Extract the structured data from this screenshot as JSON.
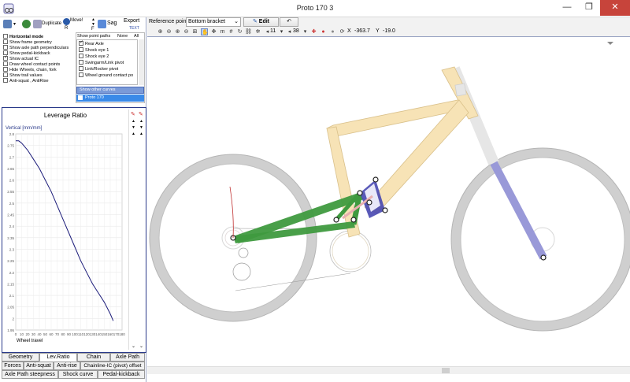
{
  "window": {
    "title": "Proto 170 3",
    "minimize": "—",
    "restore": "❐",
    "close": "✕"
  },
  "left_toolbar": {
    "duplicate_label": "Duplicate",
    "move_label": "Move!",
    "sag_label": "Sag",
    "export_label": "Export",
    "export_sub": "TEXT",
    "r_label": "R",
    "f_label": "F"
  },
  "display_options": [
    {
      "label": "Horizontal mode",
      "checked": false,
      "bold": true
    },
    {
      "label": "Show frame geometry",
      "checked": false,
      "bold": false
    },
    {
      "label": "Show axle path perpendiculars",
      "checked": false,
      "bold": false
    },
    {
      "label": "Show pedal-kickback",
      "checked": false,
      "bold": false
    },
    {
      "label": "Show actual IC",
      "checked": true,
      "bold": false
    },
    {
      "label": "Draw wheel contact points",
      "checked": false,
      "bold": false
    },
    {
      "label": "Hide Wheels, chain, fork",
      "checked": false,
      "bold": false
    },
    {
      "label": "Show trail values",
      "checked": false,
      "bold": false
    },
    {
      "label": "Anti-squat , AntiRise",
      "checked": false,
      "bold": false
    }
  ],
  "point_paths": {
    "header": "Show point paths",
    "none_label": "None",
    "all_label": "All",
    "items": [
      {
        "label": "Rear Axle",
        "checked": true
      },
      {
        "label": "Shock eye 1",
        "checked": false
      },
      {
        "label": "Shock eye 2",
        "checked": false
      },
      {
        "label": "Swingarm/Link pivot",
        "checked": false
      },
      {
        "label": "Link/Rocker pivot",
        "checked": false
      },
      {
        "label": "Wheel ground contact po",
        "checked": false
      }
    ],
    "other_curves_label": "Show other curves",
    "curve_item": "Proto 170"
  },
  "chart_data": {
    "type": "line",
    "title": "Leverage Ratio",
    "ylabel": "Vertical [mm/mm]",
    "xlabel": "Wheel travel",
    "xlim": [
      0,
      180
    ],
    "ylim": [
      1.95,
      2.8
    ],
    "x_ticks": [
      "0",
      "10",
      "20",
      "30",
      "40",
      "50",
      "60",
      "70",
      "80",
      "90",
      "100",
      "110",
      "120",
      "130",
      "140",
      "150",
      "160",
      "170",
      "180"
    ],
    "y_ticks": [
      "2.8",
      "2.75",
      "2.7",
      "2.65",
      "2.6",
      "2.55",
      "2.5",
      "2.45",
      "2.4",
      "2.35",
      "2.3",
      "2.25",
      "2.2",
      "2.15",
      "2.1",
      "2.05",
      "2",
      "1.95"
    ],
    "series": [
      {
        "color": "#1c1c7a",
        "x": [
          0,
          5,
          10,
          20,
          30,
          40,
          50,
          60,
          70,
          80,
          90,
          100,
          110,
          120,
          130,
          140,
          150,
          160,
          165
        ],
        "y": [
          2.77,
          2.77,
          2.76,
          2.73,
          2.69,
          2.65,
          2.6,
          2.55,
          2.49,
          2.43,
          2.37,
          2.31,
          2.25,
          2.2,
          2.15,
          2.11,
          2.07,
          2.02,
          1.99
        ]
      }
    ]
  },
  "tabs_row1": [
    "Geometry",
    "Lev.Ratio",
    "Chain",
    "Axle Path"
  ],
  "tabs_row2": [
    "Forces",
    "Anti-squat",
    "Anti-rise",
    "Chainline-IC (pivot) offset"
  ],
  "tabs_row3": [
    "Axle Path steepness",
    "Shock curve",
    "Pedal-kickback"
  ],
  "active_tab": "Lev.Ratio",
  "main_toolbar": {
    "reference_label": "Reference point",
    "reference_value": "Bottom bracket",
    "edit_label": "Edit",
    "undo_label": "↶",
    "front_gear": "11",
    "rear_gear": "38",
    "x_label": "X",
    "x_value": "-363.7",
    "y_label": "Y",
    "y_value": "-19.0"
  },
  "colors": {
    "frame": "#f7e3b6",
    "frame_stroke": "#d9c08a",
    "swingarm": "#3f9a3f",
    "rocker": "#4747b0",
    "fork": "#8f8fd6",
    "wheel": "#c8c8c8",
    "panel_border": "#2a3a8a"
  }
}
